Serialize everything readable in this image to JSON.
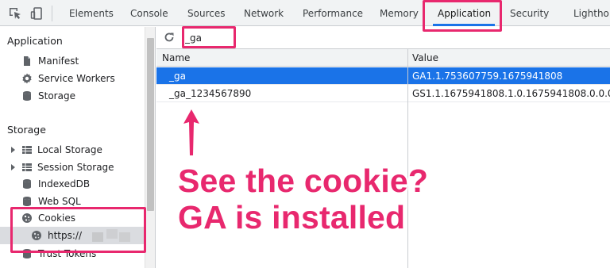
{
  "toolbar": {
    "tabs": [
      {
        "label": "Elements"
      },
      {
        "label": "Console"
      },
      {
        "label": "Sources"
      },
      {
        "label": "Network"
      },
      {
        "label": "Performance"
      },
      {
        "label": "Memory"
      },
      {
        "label": "Application"
      },
      {
        "label": "Security"
      },
      {
        "label": "Lightho"
      }
    ],
    "active_tab": "Application"
  },
  "sidebar": {
    "application_title": "Application",
    "application_items": [
      {
        "label": "Manifest",
        "icon": "document-icon"
      },
      {
        "label": "Service Workers",
        "icon": "gear-icon"
      },
      {
        "label": "Storage",
        "icon": "database-icon"
      }
    ],
    "storage_title": "Storage",
    "storage_items": [
      {
        "label": "Local Storage",
        "icon": "grid-icon",
        "expandable": true
      },
      {
        "label": "Session Storage",
        "icon": "grid-icon",
        "expandable": true
      },
      {
        "label": "IndexedDB",
        "icon": "database-icon"
      },
      {
        "label": "Web SQL",
        "icon": "database-icon"
      },
      {
        "label": "Cookies",
        "icon": "cookie-icon"
      },
      {
        "label": "https://",
        "icon": "cookie-icon",
        "selected": true
      },
      {
        "label": "Trust Tokens",
        "icon": "database-icon"
      }
    ]
  },
  "filter": {
    "value": "_ga"
  },
  "cookies_table": {
    "columns": [
      "Name",
      "Value"
    ],
    "rows": [
      {
        "name": "_ga",
        "value": "GA1.1.753607759.1675941808",
        "selected": true
      },
      {
        "name": "_ga_1234567890",
        "value": "GS1.1.1675941808.1.0.1675941808.0.0.0",
        "selected": false
      }
    ]
  },
  "annotation": {
    "line1": "See the cookie?",
    "line2": "GA is installed",
    "color": "#e8286e"
  },
  "colors": {
    "accent": "#1a73e8",
    "highlight": "#e8286e",
    "panel_bg": "#f1f3f4"
  }
}
